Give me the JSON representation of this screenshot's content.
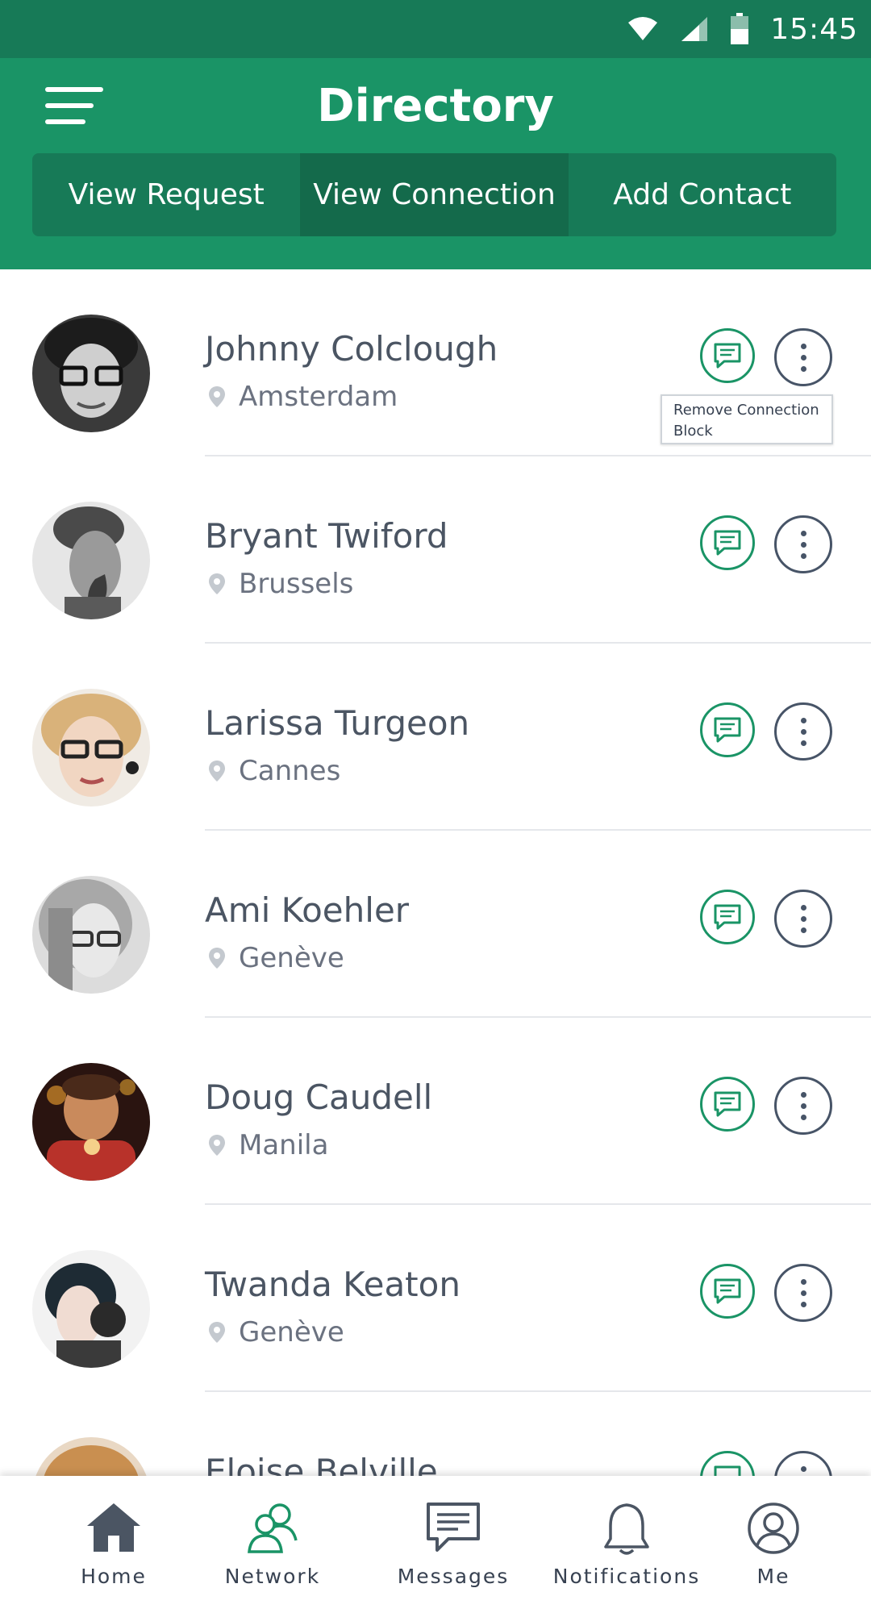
{
  "status_bar": {
    "time": "15:45"
  },
  "header": {
    "title": "Directory",
    "tabs": [
      {
        "label": "View Request",
        "active": false
      },
      {
        "label": "View Connection",
        "active": true
      },
      {
        "label": "Add Contact",
        "active": false
      }
    ]
  },
  "contacts": [
    {
      "name": "Johnny Colclough",
      "location": "Amsterdam"
    },
    {
      "name": "Bryant Twiford",
      "location": "Brussels"
    },
    {
      "name": "Larissa Turgeon",
      "location": "Cannes"
    },
    {
      "name": "Ami Koehler",
      "location": "Genève"
    },
    {
      "name": "Doug Caudell",
      "location": "Manila"
    },
    {
      "name": "Twanda Keaton",
      "location": "Genève"
    },
    {
      "name": "Eloise Belville",
      "location": ""
    }
  ],
  "context_menu": {
    "items": [
      "Remove Connection",
      "Block"
    ]
  },
  "bottom_nav": [
    {
      "label": "Home",
      "icon": "home-icon"
    },
    {
      "label": "Network",
      "icon": "network-icon",
      "active": true
    },
    {
      "label": "Messages",
      "icon": "messages-icon"
    },
    {
      "label": "Notifications",
      "icon": "bell-icon"
    },
    {
      "label": "Me",
      "icon": "profile-icon"
    }
  ],
  "colors": {
    "primary": "#1a9466",
    "primary_dark": "#177a57",
    "tab_active": "#146a4b",
    "text": "#4b5563"
  }
}
